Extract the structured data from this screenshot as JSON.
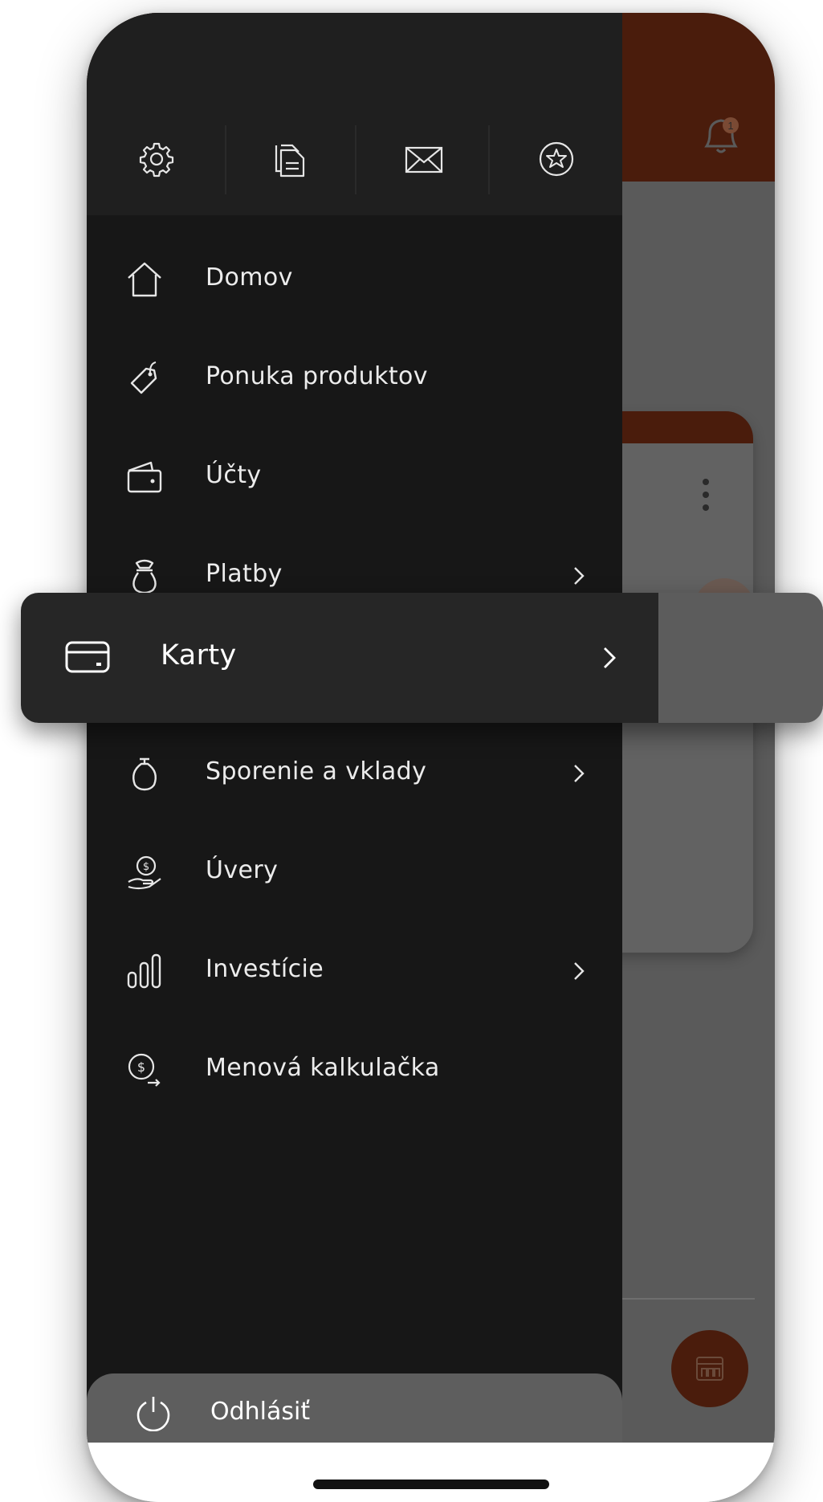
{
  "drawer": {
    "quick_actions": [
      {
        "icon": "gear-icon"
      },
      {
        "icon": "documents-icon"
      },
      {
        "icon": "envelope-icon"
      },
      {
        "icon": "star-badge-icon"
      }
    ],
    "items": [
      {
        "label": "Domov",
        "icon": "home-icon",
        "has_chevron": false
      },
      {
        "label": "Ponuka produktov",
        "icon": "price-tag-icon",
        "has_chevron": false
      },
      {
        "label": "Účty",
        "icon": "wallet-icon",
        "has_chevron": false
      },
      {
        "label": "Platby",
        "icon": "payment-pouch-icon",
        "has_chevron": true
      },
      {
        "label": "Karty",
        "icon": "credit-card-icon",
        "has_chevron": true,
        "highlighted": true
      },
      {
        "label": "Sporenie a vklady",
        "icon": "savings-pot-icon",
        "has_chevron": true
      },
      {
        "label": "Úvery",
        "icon": "loan-hand-icon",
        "has_chevron": false
      },
      {
        "label": "Investície",
        "icon": "bars-icon",
        "has_chevron": true
      },
      {
        "label": "Menová kalkulačka",
        "icon": "currency-exchange-icon",
        "has_chevron": false
      }
    ],
    "logout_label": "Odhlásiť"
  },
  "background": {
    "notification_badge": "1"
  },
  "colors": {
    "drawer_bg": "#171717",
    "drawer_top_bg": "#1f1f1f",
    "accent_brown": "#4a1c0c",
    "highlight_bg": "#262626",
    "logout_bg": "#5e5e5e"
  }
}
